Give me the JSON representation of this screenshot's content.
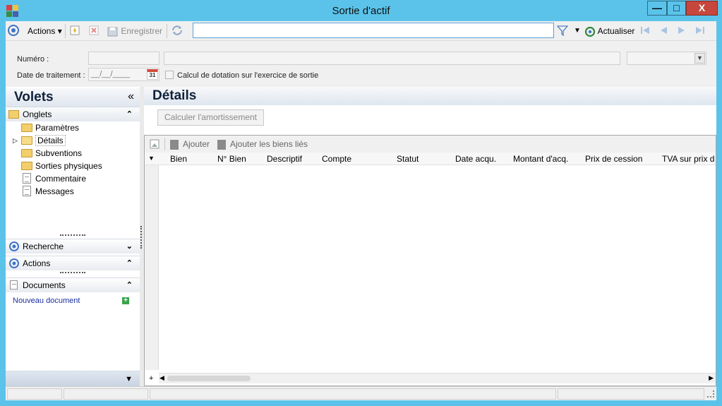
{
  "window": {
    "title": "Sortie d'actif",
    "minimize": "—",
    "maximize": "□",
    "close": "X"
  },
  "toolbar": {
    "actions_label": "Actions",
    "save_label": "Enregistrer",
    "search_value": "",
    "refresh_label": "Actualiser",
    "icons": [
      "circle-target-icon",
      "new-icon",
      "delete-icon",
      "save-icon",
      "sync-icon",
      "filter-icon",
      "refresh-icon",
      "first-icon",
      "prev-icon",
      "next-icon",
      "last-icon"
    ]
  },
  "form": {
    "numero_label": "Numéro :",
    "numero_value": "",
    "description_value": "",
    "date_label": "Date de traitement :",
    "date_value": "__/__/____",
    "calendar_day": "31",
    "checkbox_label": "Calcul de dotation sur l'exercice de sortie",
    "checkbox_checked": false
  },
  "sidebar": {
    "title": "Volets",
    "collapse_glyph": "«",
    "onglets_label": "Onglets",
    "items": [
      {
        "label": "Paramètres",
        "icon": "folder-icon"
      },
      {
        "label": "Détails",
        "icon": "folder-open-icon",
        "selected": true
      },
      {
        "label": "Subventions",
        "icon": "folder-icon"
      },
      {
        "label": "Sorties physiques",
        "icon": "folder-icon"
      },
      {
        "label": "Commentaire",
        "icon": "document-icon"
      },
      {
        "label": "Messages",
        "icon": "document-icon"
      }
    ],
    "recherche_label": "Recherche",
    "actions_label": "Actions",
    "documents_label": "Documents",
    "new_document_label": "Nouveau document"
  },
  "main": {
    "title": "Détails",
    "calc_button": "Calculer l'amortissement",
    "grid": {
      "add_label": "Ajouter",
      "add_linked_label": "Ajouter les biens liés",
      "columns": [
        "Bien",
        "N° Bien",
        "Descriptif",
        "Compte",
        "Statut",
        "Date acqu.",
        "Montant d'acq.",
        "Prix de cession",
        "TVA sur prix d"
      ],
      "rows": []
    }
  },
  "colors": {
    "title_bar": "#5bc3ea",
    "panel_header_text": "#10213a",
    "link": "#1a2f9c",
    "close": "#c7473c"
  }
}
